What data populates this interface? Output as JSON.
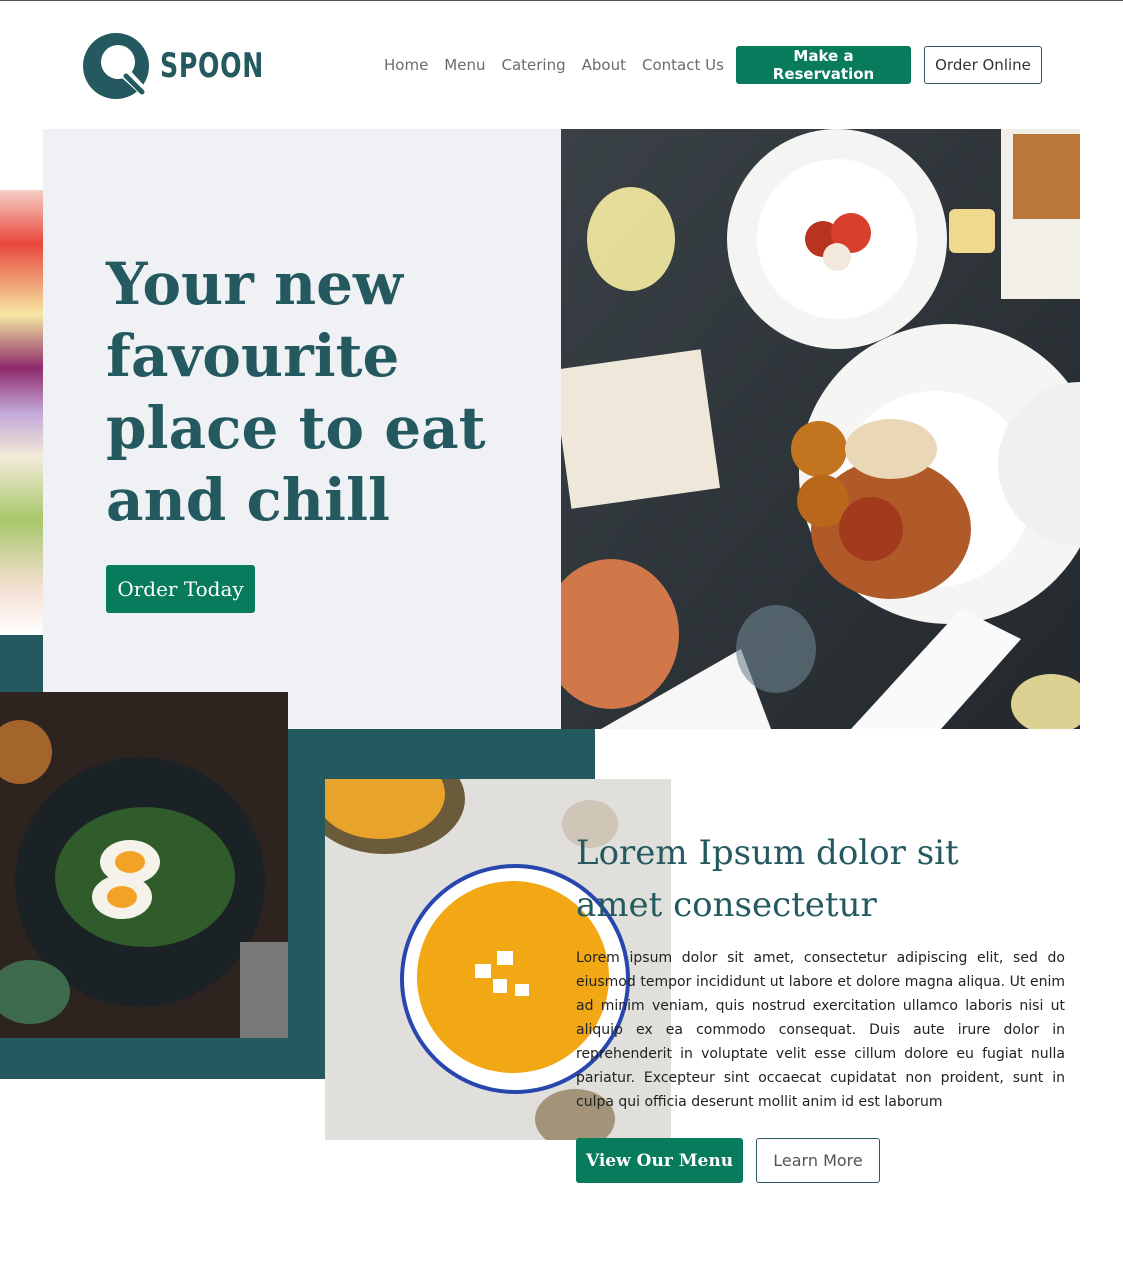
{
  "brand": {
    "name": "SPOON",
    "logo_icon": "spoon-logo-icon",
    "primary_color": "#245a5f",
    "accent_color": "#077b5c",
    "panel_color": "#f0f1f5"
  },
  "nav": {
    "items": [
      {
        "label": "Home"
      },
      {
        "label": "Menu"
      },
      {
        "label": "Catering"
      },
      {
        "label": "About"
      },
      {
        "label": "Contact Us"
      }
    ],
    "reserve_label": "Make a Reservation",
    "order_online_label": "Order Online"
  },
  "hero": {
    "title": "Your new favourite place to eat and chill",
    "cta_label": "Order Today"
  },
  "section": {
    "title": "Lorem Ipsum dolor sit amet consectetur",
    "body": "Lorem ipsum dolor sit amet, consectetur adipiscing elit, sed do eiusmod tempor incididunt ut labore et dolore magna aliqua. Ut enim ad minim veniam, quis nostrud exercitation ullamco laboris nisi ut aliquip ex ea commodo consequat. Duis aute irure dolor in reprehenderit in voluptate velit esse cillum dolore eu fugiat nulla pariatur. Excepteur sint occaecat cupidatat non proident, sunt in culpa qui officia deserunt mollit anim id est laborum",
    "primary_label": "View Our Menu",
    "secondary_label": "Learn More"
  }
}
